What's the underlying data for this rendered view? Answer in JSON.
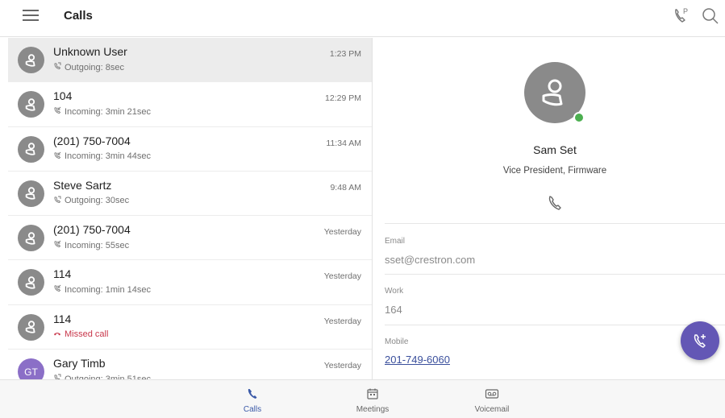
{
  "header": {
    "title": "Calls"
  },
  "calls": [
    {
      "name": "Unknown User",
      "direction": "Outgoing",
      "detail": "Outgoing: 8sec",
      "time": "1:23 PM",
      "selected": true
    },
    {
      "name": "104",
      "direction": "Incoming",
      "detail": "Incoming: 3min 21sec",
      "time": "12:29 PM"
    },
    {
      "name": "(201) 750-7004",
      "direction": "Incoming",
      "detail": "Incoming: 3min 44sec",
      "time": "11:34 AM"
    },
    {
      "name": "Steve Sartz",
      "direction": "Outgoing",
      "detail": "Outgoing: 30sec",
      "time": "9:48 AM"
    },
    {
      "name": "(201) 750-7004",
      "direction": "Incoming",
      "detail": "Incoming: 55sec",
      "time": "Yesterday"
    },
    {
      "name": "114",
      "direction": "Incoming",
      "detail": "Incoming: 1min 14sec",
      "time": "Yesterday"
    },
    {
      "name": "114",
      "direction": "Missed",
      "detail": "Missed call",
      "time": "Yesterday"
    },
    {
      "name": "Gary Timb",
      "initials": "GT",
      "direction": "Outgoing",
      "detail": "Outgoing: 3min 51sec",
      "time": "Yesterday"
    }
  ],
  "contact": {
    "name": "Sam Set",
    "title": "Vice President, Firmware",
    "presence": "available",
    "email_label": "Email",
    "email": "sset@crestron.com",
    "work_label": "Work",
    "work": "164",
    "mobile_label": "Mobile",
    "mobile": "201-749-6060"
  },
  "nav": {
    "calls": "Calls",
    "meetings": "Meetings",
    "voicemail": "Voicemail"
  },
  "colors": {
    "accent": "#6357b5",
    "missed": "#c8364a",
    "presence": "#4caf50",
    "link": "#3a4f9c"
  }
}
